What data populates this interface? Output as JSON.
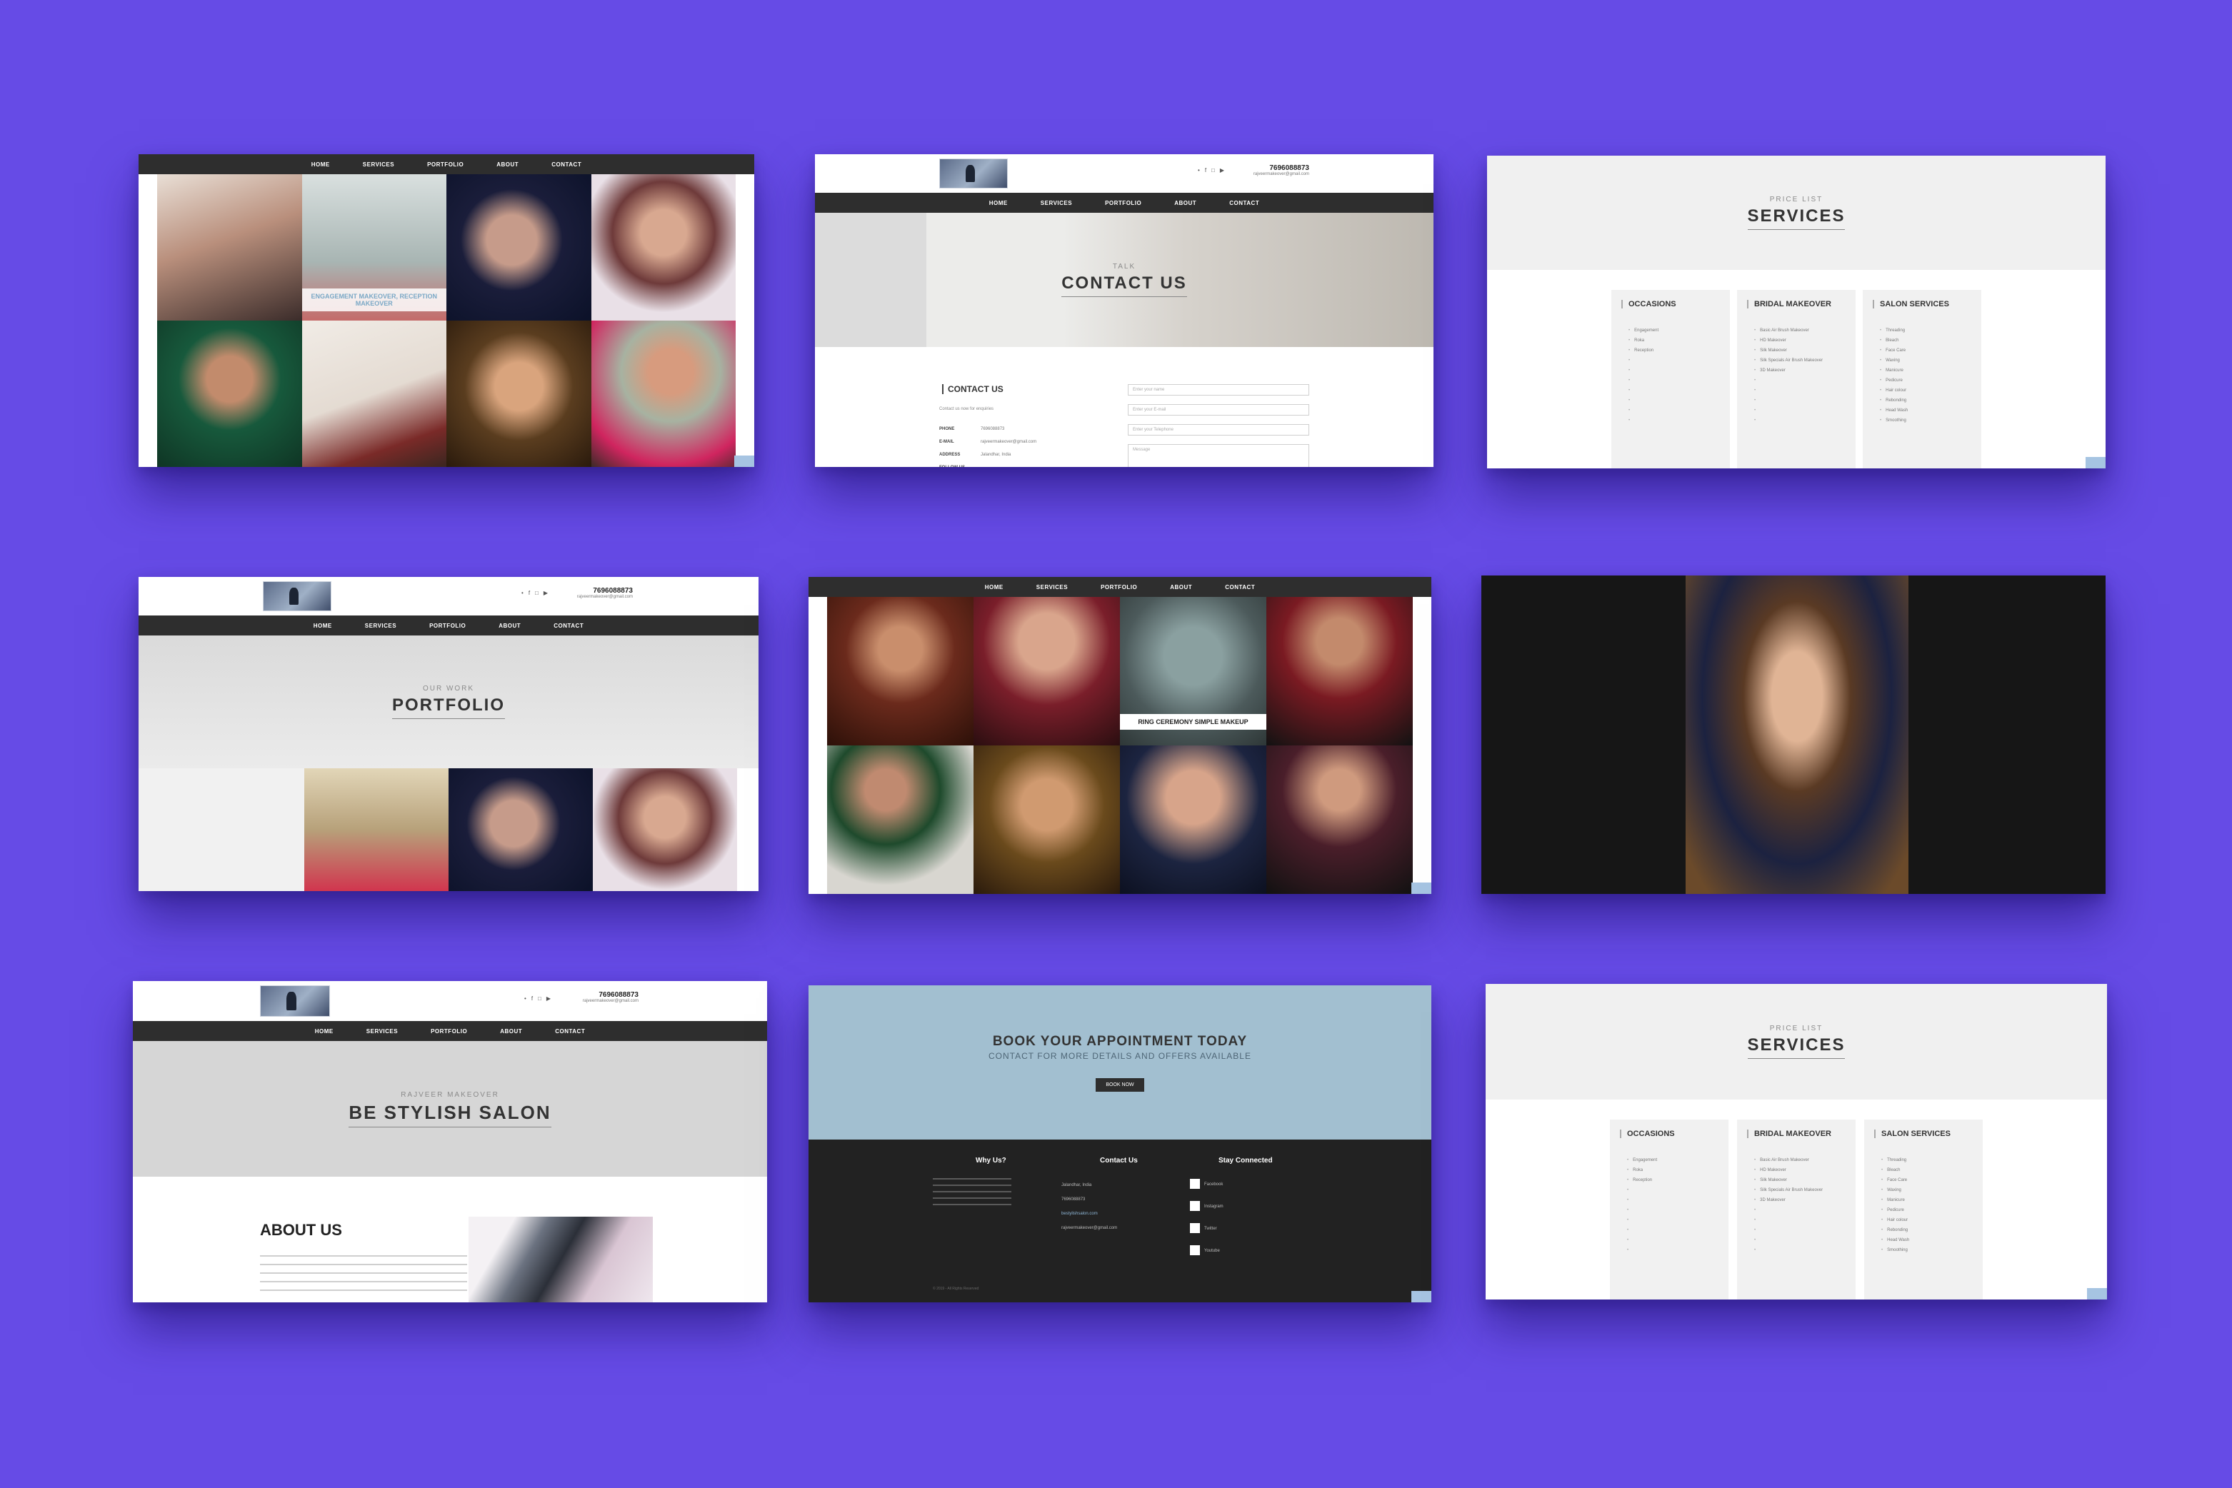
{
  "nav": [
    "HOME",
    "SERVICES",
    "PORTFOLIO",
    "ABOUT",
    "CONTACT"
  ],
  "header": {
    "phone": "7696088873",
    "email": "rajveermakeover@gmail.com",
    "social": [
      "•",
      "f",
      "□",
      "▶"
    ]
  },
  "tiles": {
    "gallery1": {
      "caption": "ENGAGEMENT MAKEOVER, RECEPTION MAKEOVER"
    },
    "contact": {
      "eyebrow": "TALK",
      "title": "CONTACT US",
      "section_title": "CONTACT US",
      "intro": "Contact us now for enquiries",
      "labels": [
        "PHONE",
        "E-MAIL",
        "ADDRESS",
        "FOLLOW US"
      ],
      "values": [
        "7696088873",
        "rajveermakeover@gmail.com",
        "Jalandhar, India",
        ""
      ],
      "fields": [
        "Enter your name",
        "Enter your E-mail",
        "Enter your Telephone",
        "Message"
      ]
    },
    "services": {
      "eyebrow": "PRICE LIST",
      "title": "SERVICES",
      "columns": [
        {
          "title": "OCCASIONS",
          "items": [
            "Engagement",
            "Roka",
            "Reception",
            "",
            "",
            "",
            "",
            "",
            "",
            ""
          ]
        },
        {
          "title": "BRIDAL MAKEOVER",
          "items": [
            "Basic Air Brush Makeover",
            "HD Makeover",
            "Silk Makeover",
            "Silk Specials Air Brush Makeover",
            "3D Makeover",
            "",
            "",
            "",
            "",
            ""
          ]
        },
        {
          "title": "SALON SERVICES",
          "items": [
            "Threading",
            "Bleach",
            "Face Care",
            "Waxing",
            "Manicure",
            "Pedicure",
            "Hair colour",
            "Rebonding",
            "Head Wash",
            "Smoothing"
          ]
        }
      ]
    },
    "portfolio": {
      "eyebrow": "OUR WORK",
      "title": "PORTFOLIO"
    },
    "gallery2": {
      "caption": "RING CEREMONY SIMPLE MAKEUP"
    },
    "about": {
      "eyebrow": "RAJVEER MAKEOVER",
      "title": "BE STYLISH SALON",
      "section_title": "ABOUT US"
    },
    "book": {
      "title": "BOOK YOUR APPOINTMENT TODAY",
      "subtitle": "CONTACT FOR MORE DETAILS AND OFFERS AVAILABLE",
      "button": "BOOK NOW",
      "why_title": "Why Us?",
      "contact_title": "Contact Us",
      "stay_title": "Stay Connected",
      "contact_lines": [
        "Jalandhar, India",
        "7696088873",
        "bestylishsalon.com",
        "rajveermakeover@gmail.com"
      ],
      "social_labels": [
        "Facebook",
        "Instagram",
        "Twitter",
        "Youtube"
      ],
      "copyright": "© 2019 - All Rights Reserved"
    }
  },
  "colors": {
    "background": "#664be6",
    "nav": "#2e2e2e",
    "accent": "#a6c4e2",
    "booking_band": "#a2bfd0"
  }
}
